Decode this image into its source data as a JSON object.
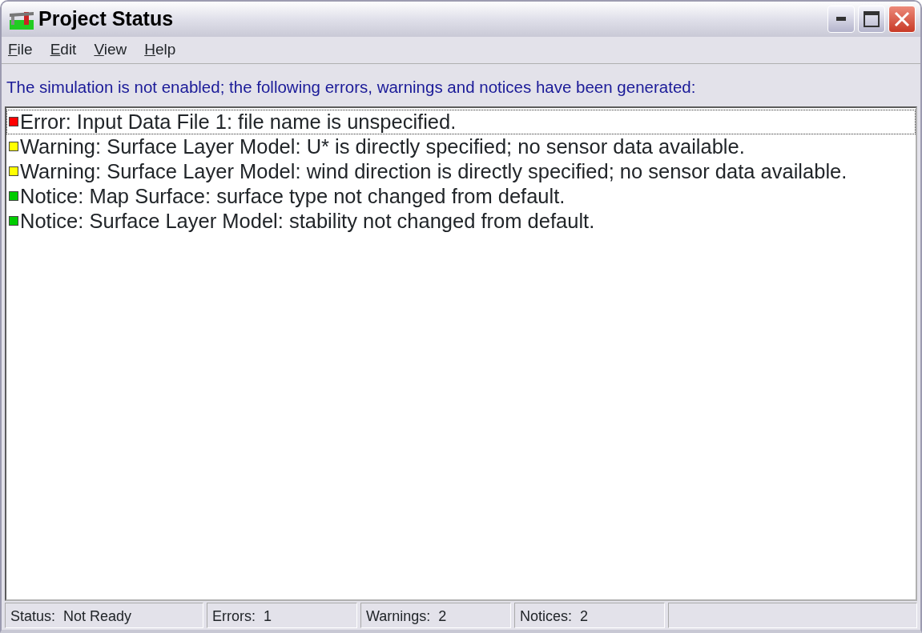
{
  "window": {
    "title": "Project Status"
  },
  "menu": [
    {
      "label": "File"
    },
    {
      "label": "Edit"
    },
    {
      "label": "View"
    },
    {
      "label": "Help"
    }
  ],
  "message": "The simulation is not enabled; the following errors, warnings and notices have been generated:",
  "items": [
    {
      "text": "Error: Input Data File 1: file name is unspecified.",
      "color": "#ff0000",
      "selected": true
    },
    {
      "text": "Warning: Surface Layer Model: U* is directly specified; no sensor data available.",
      "color": "#ffff00",
      "selected": false
    },
    {
      "text": "Warning: Surface Layer Model: wind direction is directly specified; no sensor data available.",
      "color": "#ffff00",
      "selected": false
    },
    {
      "text": "Notice: Map Surface: surface type not changed from default.",
      "color": "#00cc00",
      "selected": false
    },
    {
      "text": "Notice: Surface Layer Model: stability not changed from default.",
      "color": "#00cc00",
      "selected": false
    }
  ],
  "status_bar": [
    "Status:  Not Ready",
    "Errors:  1",
    "Warnings:  2",
    "Notices:  2"
  ]
}
